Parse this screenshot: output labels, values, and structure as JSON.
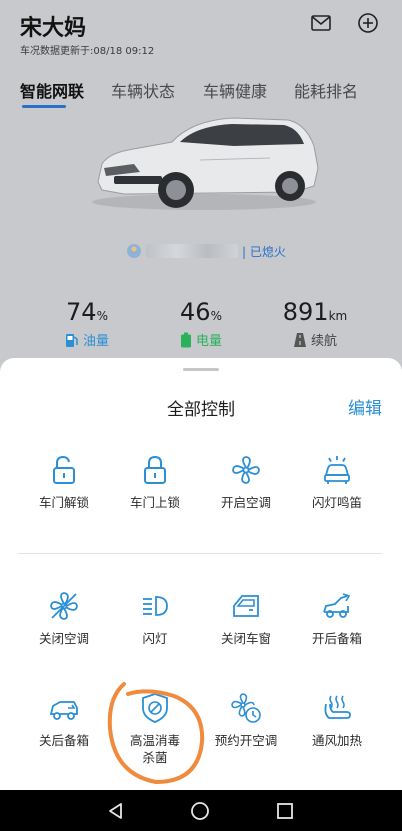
{
  "header": {
    "title": "宋大妈",
    "update_text": "车况数据更新于:08/18 09:12",
    "icons": [
      "mail-icon",
      "add-circle-icon"
    ]
  },
  "tabs": [
    {
      "label": "智能网联",
      "active": true
    },
    {
      "label": "车辆状态",
      "active": false
    },
    {
      "label": "车辆健康",
      "active": false
    },
    {
      "label": "能耗排名",
      "active": false
    }
  ],
  "vehicle_status": {
    "state_text": "| 已熄火"
  },
  "stats": [
    {
      "value": "74",
      "unit": "%",
      "label": "油量",
      "icon": "fuel-icon",
      "color": "#2a8fd4"
    },
    {
      "value": "46",
      "unit": "%",
      "label": "电量",
      "icon": "battery-icon",
      "color": "#2bb15a"
    },
    {
      "value": "891",
      "unit": "km",
      "label": "续航",
      "icon": "road-icon",
      "color": "#444444"
    }
  ],
  "sheet": {
    "title": "全部控制",
    "edit_label": "编辑",
    "controls": [
      {
        "label": "车门解锁",
        "icon": "unlock-icon"
      },
      {
        "label": "车门上锁",
        "icon": "lock-icon"
      },
      {
        "label": "开启空调",
        "icon": "fan-icon"
      },
      {
        "label": "闪灯鸣笛",
        "icon": "car-horn-icon"
      },
      {
        "label": "关闭空调",
        "icon": "fan-off-icon"
      },
      {
        "label": "闪灯",
        "icon": "headlight-icon"
      },
      {
        "label": "关闭车窗",
        "icon": "car-window-icon"
      },
      {
        "label": "开后备箱",
        "icon": "trunk-open-icon"
      },
      {
        "label": "关后备箱",
        "icon": "trunk-close-icon"
      },
      {
        "label": "高温消毒\n杀菌",
        "icon": "sterilize-icon"
      },
      {
        "label": "预约开空调",
        "icon": "schedule-ac-icon"
      },
      {
        "label": "通风加热",
        "icon": "seat-ventilation-icon"
      }
    ]
  },
  "colors": {
    "accent": "#2a8fd4",
    "annotation": "#f08a3c"
  }
}
